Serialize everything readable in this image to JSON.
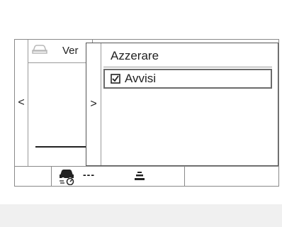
{
  "screen": {
    "back_page": {
      "title": "Ver",
      "icon": "car-icon",
      "left_arrow_glyph": "<"
    },
    "menu": {
      "back_arrow_glyph": ">",
      "title": "Azzerare",
      "items": [
        {
          "label": "Avvisi",
          "checked": true,
          "icon": "checkbox-checked-icon"
        }
      ]
    },
    "status_bar": {
      "driver_assist_icon": "driver-assist-icon",
      "value_text": "---",
      "lane_icon": "lane-icon"
    }
  },
  "colors": {
    "border": "#8a8a8a",
    "text": "#1a1a1a",
    "background": "#ffffff"
  }
}
